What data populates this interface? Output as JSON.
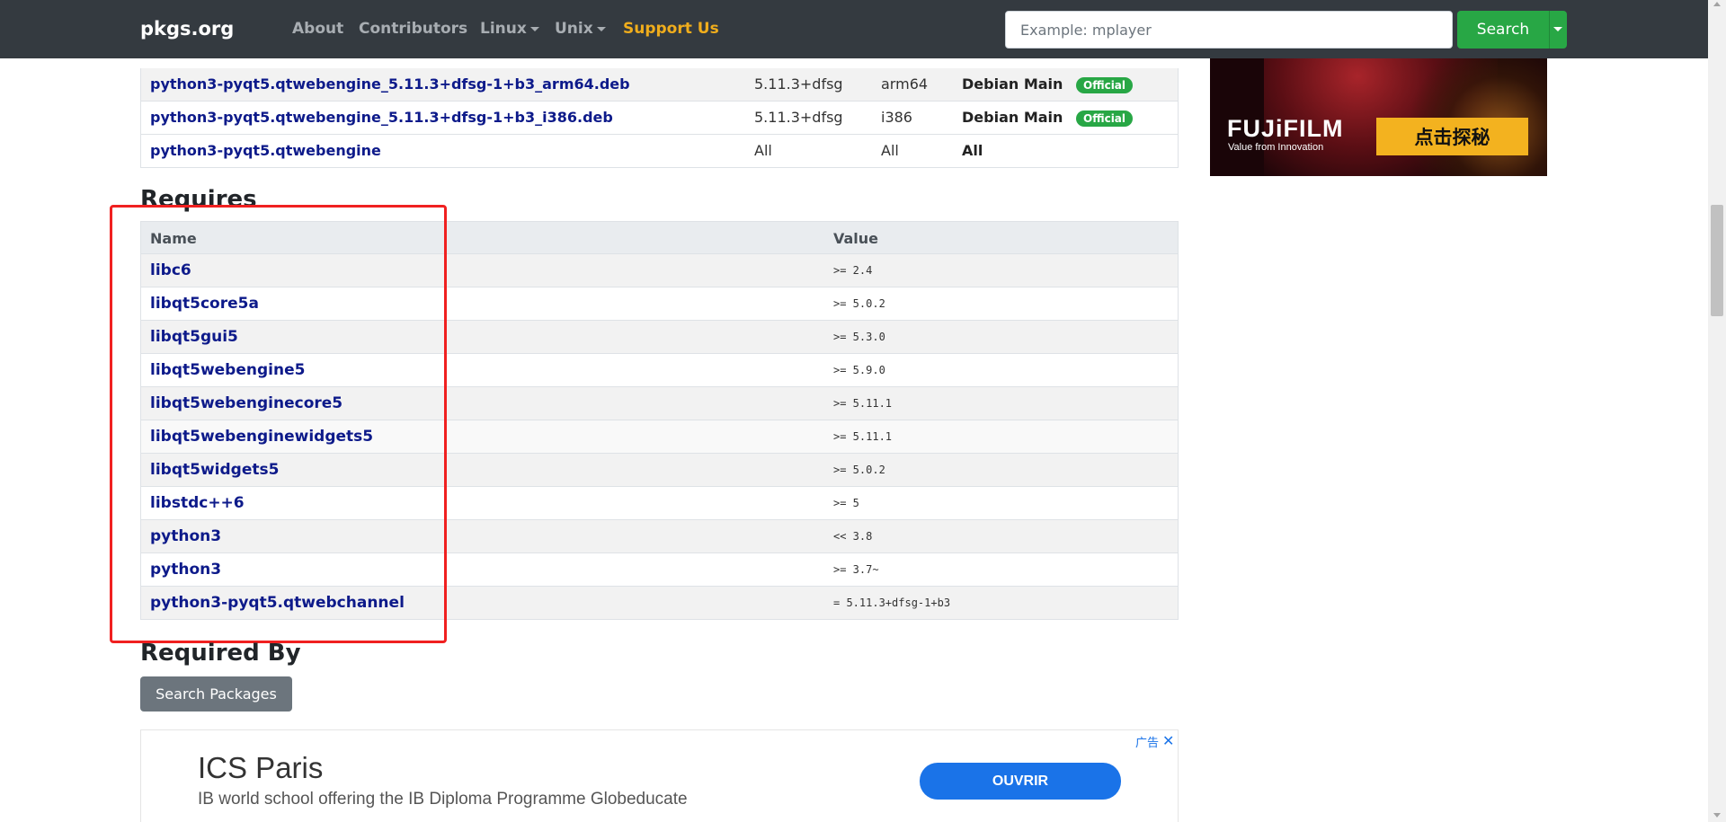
{
  "navbar": {
    "brand": "pkgs.org",
    "links": [
      {
        "label": "About"
      },
      {
        "label": "Contributors"
      },
      {
        "label": "Linux"
      },
      {
        "label": "Unix"
      },
      {
        "label": "Support Us"
      }
    ],
    "search_placeholder": "Example: mplayer",
    "search_button": "Search"
  },
  "packages": [
    {
      "name": "python3-pyqt5.qtwebengine_5.11.3+dfsg-1+b3_arm64.deb",
      "version": "5.11.3+dfsg",
      "arch": "arm64",
      "repo": "Debian Main",
      "badge": "Official"
    },
    {
      "name": "python3-pyqt5.qtwebengine_5.11.3+dfsg-1+b3_i386.deb",
      "version": "5.11.3+dfsg",
      "arch": "i386",
      "repo": "Debian Main",
      "badge": "Official"
    },
    {
      "name": "python3-pyqt5.qtwebengine",
      "version": "All",
      "arch": "All",
      "repo": "All",
      "badge": ""
    }
  ],
  "requires": {
    "title": "Requires",
    "columns": {
      "name": "Name",
      "value": "Value"
    },
    "rows": [
      {
        "name": "libc6",
        "value": ">= 2.4"
      },
      {
        "name": "libqt5core5a",
        "value": ">= 5.0.2"
      },
      {
        "name": "libqt5gui5",
        "value": ">= 5.3.0"
      },
      {
        "name": "libqt5webengine5",
        "value": ">= 5.9.0"
      },
      {
        "name": "libqt5webenginecore5",
        "value": ">= 5.11.1"
      },
      {
        "name": "libqt5webenginewidgets5",
        "value": ">= 5.11.1"
      },
      {
        "name": "libqt5widgets5",
        "value": ">= 5.0.2"
      },
      {
        "name": "libstdc++6",
        "value": ">= 5"
      },
      {
        "name": "python3",
        "value": "<< 3.8"
      },
      {
        "name": "python3",
        "value": ">= 3.7~"
      },
      {
        "name": "python3-pyqt5.qtwebchannel",
        "value": "= 5.11.3+dfsg-1+b3"
      }
    ]
  },
  "required_by": {
    "title": "Required By",
    "button": "Search Packages"
  },
  "ad_bottom": {
    "title": "ICS Paris",
    "description": "IB world school offering the IB Diploma Programme Globeducate",
    "button": "OUVRIR",
    "label": "广告",
    "close": "✕"
  },
  "ad_right": {
    "logo": "FUJiFILM",
    "tagline": "Value from Innovation",
    "button": "点击探秘"
  },
  "colors": {
    "navbar_bg": "#343a40",
    "link_blue": "#0d1a8a",
    "success": "#28a745",
    "support": "#f0ad1c",
    "highlight": "#f02020"
  }
}
